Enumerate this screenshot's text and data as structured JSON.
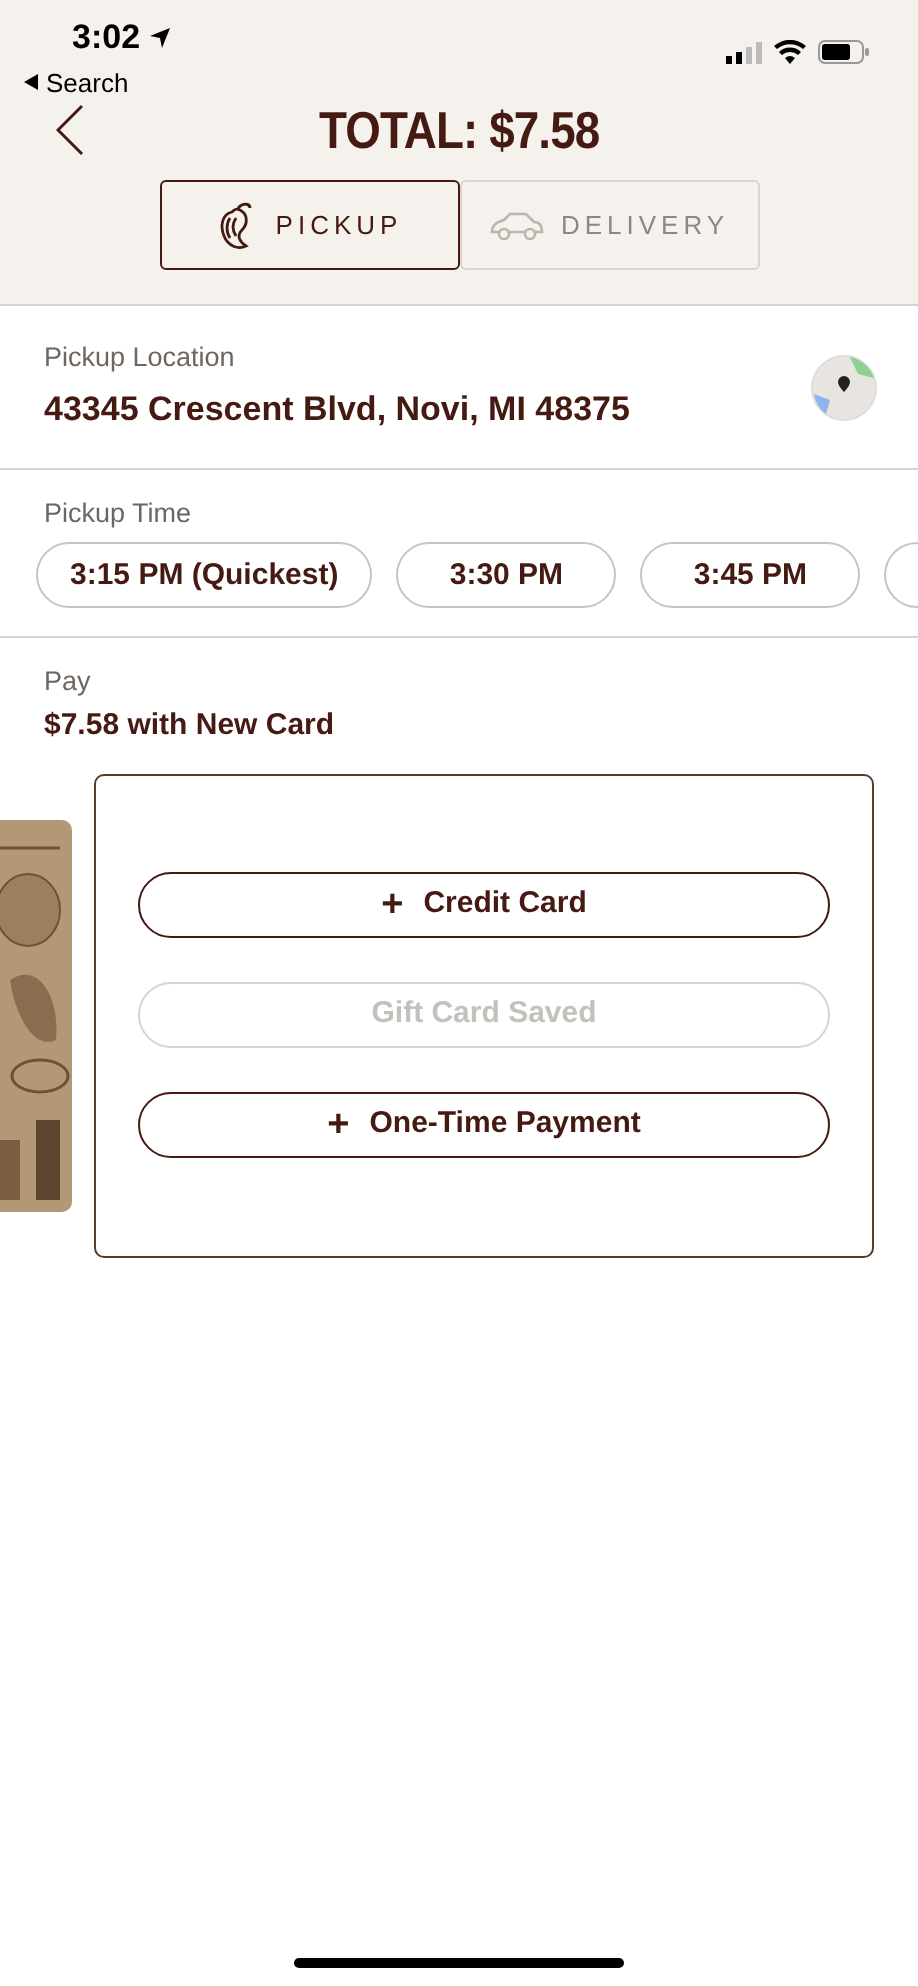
{
  "status_bar": {
    "time": "3:02",
    "back_label": "Search"
  },
  "header": {
    "title": "TOTAL: $7.58"
  },
  "tabs": [
    {
      "label": "PICKUP",
      "kind": "pickup",
      "selected": true
    },
    {
      "label": "DELIVERY",
      "kind": "delivery",
      "selected": false
    }
  ],
  "location": {
    "label": "Pickup Location",
    "address": "43345 Crescent Blvd, Novi, MI 48375"
  },
  "pickup_time": {
    "label": "Pickup Time",
    "options": [
      "3:15 PM (Quickest)",
      "3:30 PM",
      "3:45 PM"
    ]
  },
  "pay": {
    "label": "Pay",
    "summary": "$7.58 with New Card",
    "buttons": [
      {
        "icon": "+",
        "label": "Credit Card",
        "disabled": false
      },
      {
        "label": "Gift Card Saved",
        "disabled": true
      },
      {
        "icon": "+",
        "label": "One-Time Payment",
        "disabled": false
      }
    ]
  }
}
